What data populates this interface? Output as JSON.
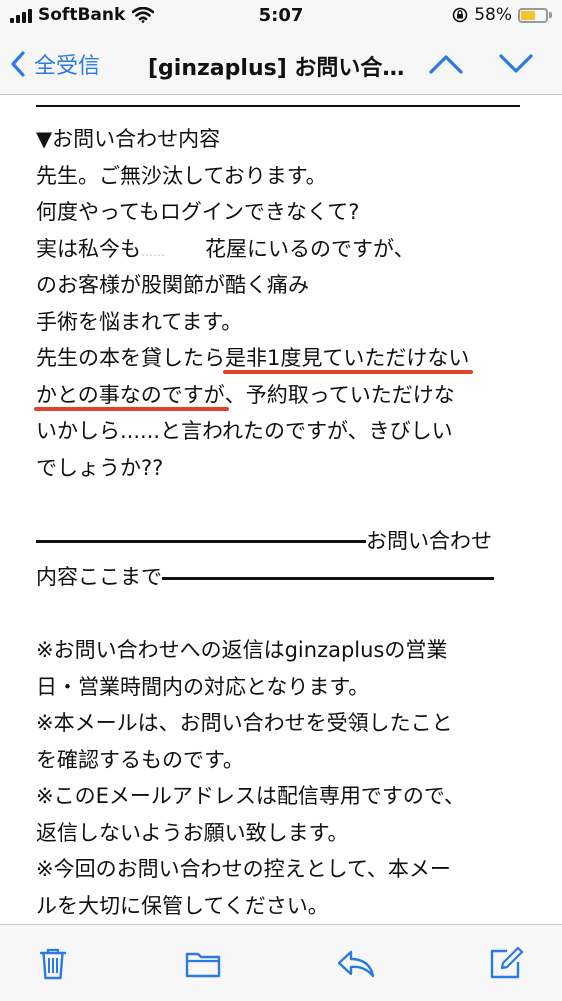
{
  "status_bar": {
    "carrier": "SoftBank",
    "time": "5:07",
    "battery_percent": "58%",
    "battery_level": 0.58,
    "battery_color": "#f2c230"
  },
  "nav": {
    "back_label": "全受信",
    "title": "[ginzaplus] お問い合…",
    "accent_color": "#2a7ae2"
  },
  "email": {
    "header_line": "▼お問い合わせ内容",
    "line1": "先生。ご無沙汰しております。",
    "line2": "何度やってもログインできなくて?",
    "line3_a": "実は私今も",
    "line3_masked": "……",
    "line3_b": "花屋にいるのですが、",
    "line4": "のお客様が股関節が酷く痛み",
    "line5": "手術を悩まれてます。",
    "line6_a": "先生の本を貸したら",
    "line6_b": "是非1度見ていただけない",
    "line7_a": "かとの事なのですが",
    "line7_b": "、予約取っていただけな",
    "line8": "いかしら......と言われたのですが、きびしい",
    "line9": "でしょうか??",
    "divider_end_label": "お問い合わせ",
    "divider_start_label": "内容ここまで",
    "notice1a": "※お問い合わせへの返信はginzaplusの営業",
    "notice1b": "日・営業時間内の対応となります。",
    "notice2a": "※本メールは、お問い合わせを受領したこと",
    "notice2b": "を確認するものです。",
    "notice3a": "※このEメールアドレスは配信専用ですので、",
    "notice3b": "返信しないようお願い致します。",
    "notice4a": "※今回のお問い合わせの控えとして、本メー",
    "notice4b": "ルを大切に保管してください。",
    "highlight_color": "#e0452b"
  },
  "toolbar": {
    "icons": [
      "trash-icon",
      "folder-icon",
      "reply-icon",
      "compose-icon"
    ]
  }
}
